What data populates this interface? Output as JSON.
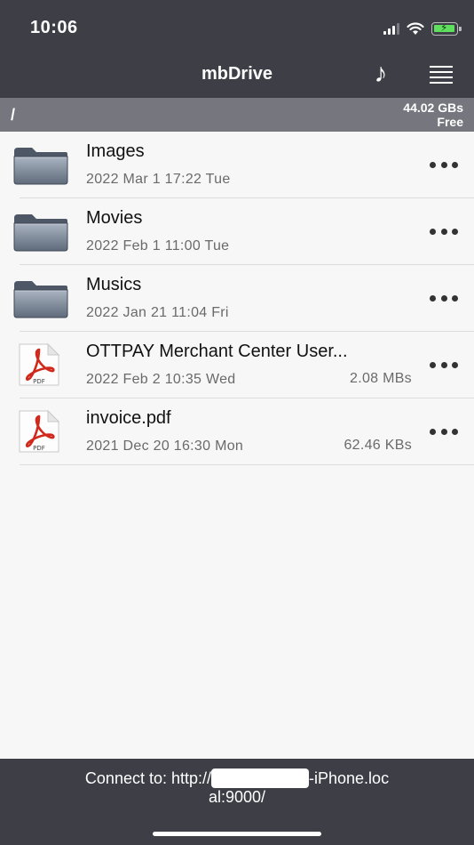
{
  "status_bar": {
    "time": "10:06"
  },
  "nav": {
    "title": "mbDrive",
    "music_icon": "music-note-icon",
    "menu_icon": "menu-icon"
  },
  "path_bar": {
    "path": "/",
    "free_space": "44.02 GBs",
    "free_label": "Free"
  },
  "files": [
    {
      "type": "folder",
      "name": "Images",
      "date": "2022 Mar 1  17:22 Tue",
      "size": ""
    },
    {
      "type": "folder",
      "name": "Movies",
      "date": "2022 Feb 1  11:00 Tue",
      "size": ""
    },
    {
      "type": "folder",
      "name": "Musics",
      "date": "2022 Jan 21  11:04 Fri",
      "size": ""
    },
    {
      "type": "pdf",
      "name": "OTTPAY Merchant Center User...",
      "date": "2022 Feb 2  10:35 Wed",
      "size": "2.08 MBs"
    },
    {
      "type": "pdf",
      "name": "invoice.pdf",
      "date": "2021 Dec 20  16:30 Mon",
      "size": "62.46 KBs"
    }
  ],
  "footer": {
    "connect_prefix": "Connect to: http://",
    "connect_suffix_line1": "-iPhone.loc",
    "connect_line2": "al:9000/"
  }
}
